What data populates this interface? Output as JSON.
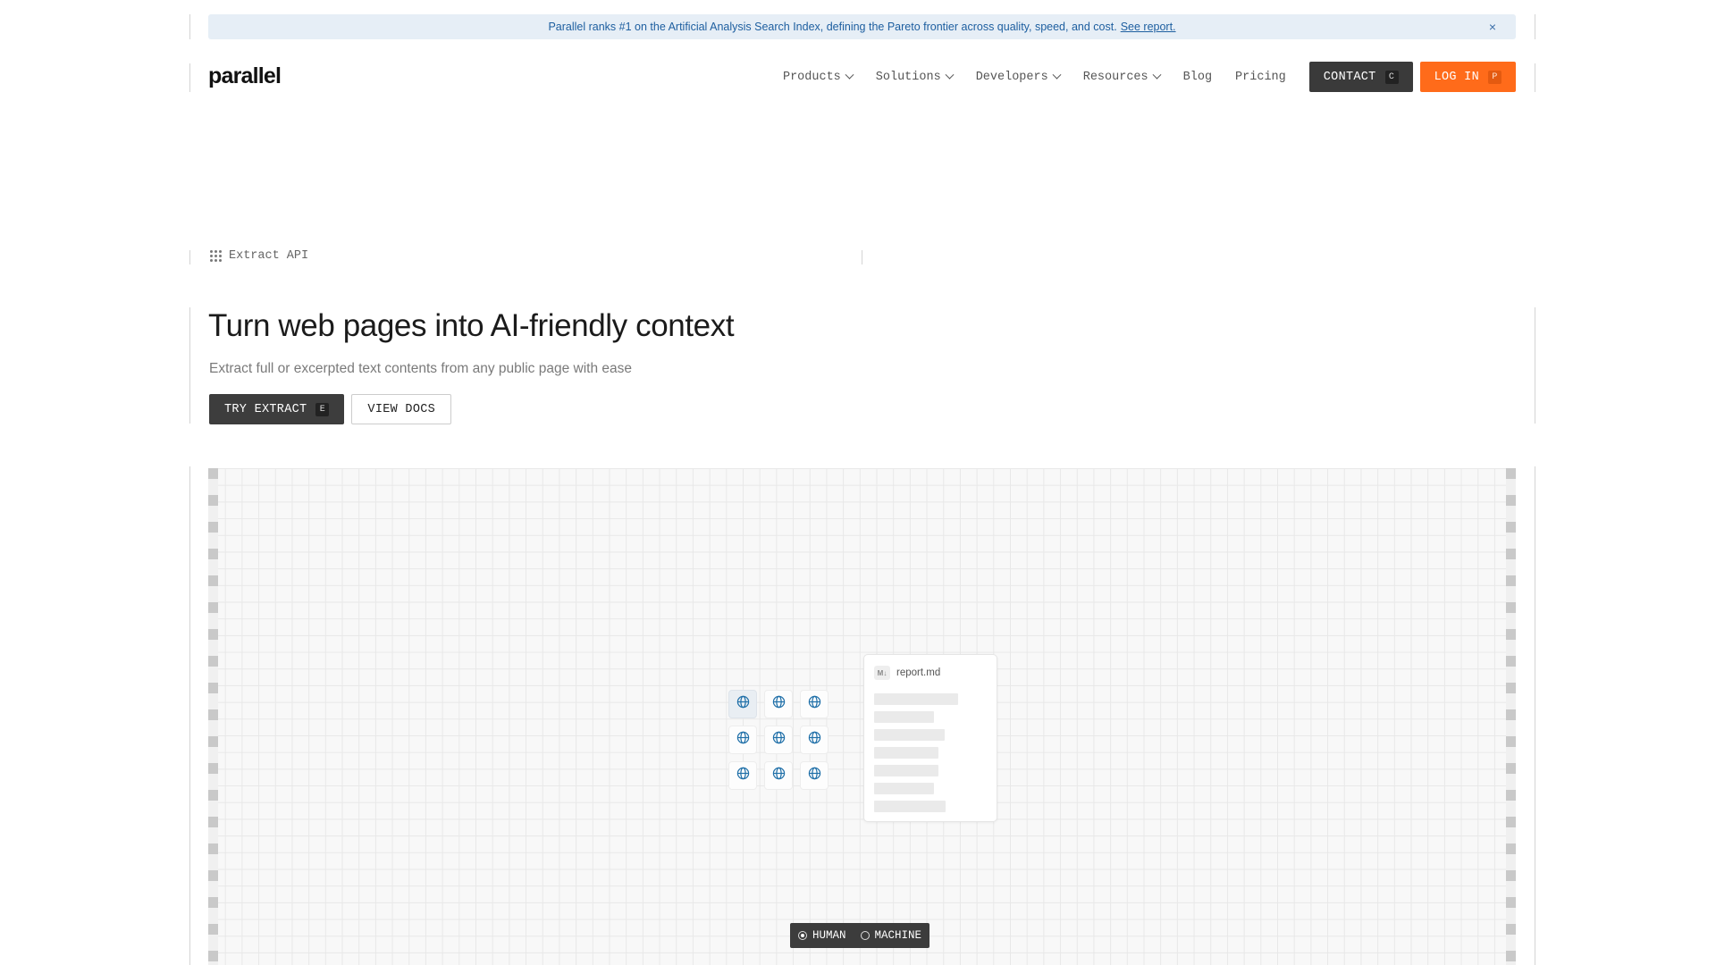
{
  "announcement": {
    "text": "Parallel ranks #1 on the Artificial Analysis Search Index, defining the Pareto frontier across quality, speed, and cost.",
    "link": "See report.",
    "close_icon": "close-icon"
  },
  "header": {
    "logo": "parallel",
    "nav": [
      {
        "label": "Products",
        "has_dropdown": true
      },
      {
        "label": "Solutions",
        "has_dropdown": true
      },
      {
        "label": "Developers",
        "has_dropdown": true
      },
      {
        "label": "Resources",
        "has_dropdown": true
      },
      {
        "label": "Blog",
        "has_dropdown": false
      },
      {
        "label": "Pricing",
        "has_dropdown": false
      }
    ],
    "contact": {
      "label": "CONTACT",
      "shortcut": "C"
    },
    "login": {
      "label": "LOG IN",
      "shortcut": "P"
    }
  },
  "hero": {
    "product_label": "Extract API",
    "title": "Turn web pages into AI-friendly context",
    "subtitle": "Extract full or excerpted text contents from any public page with ease",
    "primary_button": {
      "label": "TRY EXTRACT",
      "shortcut": "E"
    },
    "secondary_button": {
      "label": "VIEW DOCS"
    }
  },
  "demo": {
    "globe_icon": "globe-icon",
    "doc_card": {
      "badge": "M↓",
      "filename": "report.md"
    },
    "toggle": {
      "human": "HUMAN",
      "machine": "MACHINE",
      "selected": "HUMAN"
    }
  },
  "colors": {
    "accent_orange": "#ff6b1a",
    "dark_button": "#3a3a3a",
    "announce_bg": "#e6eef6",
    "announce_text": "#1e5fa0",
    "globe_blue": "#1f6fa8"
  }
}
